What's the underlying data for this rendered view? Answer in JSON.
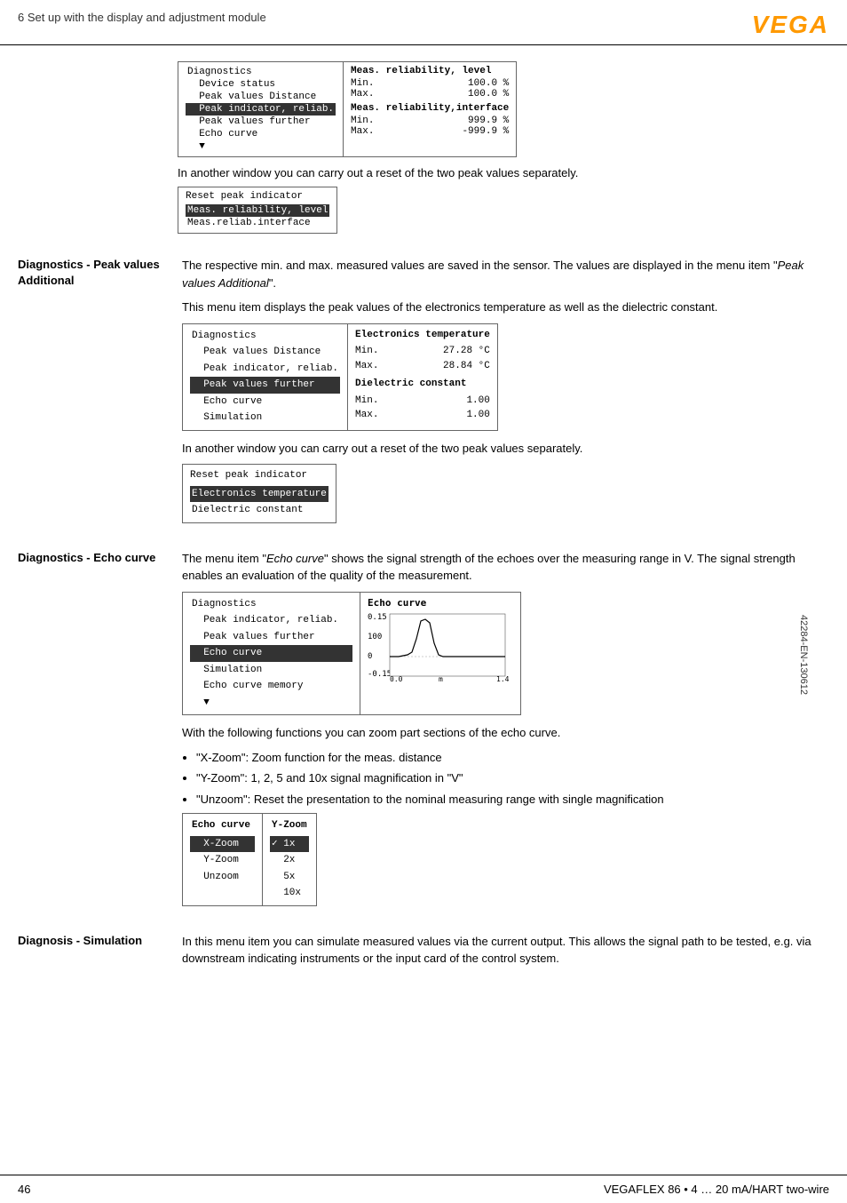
{
  "header": {
    "title": "6 Set up with the display and adjustment module",
    "logo": "VEGA"
  },
  "footer": {
    "page": "46",
    "product": "VEGAFLEX 86 • 4 … 20 mA/HART two-wire"
  },
  "doc_number": "42284-EN-130612",
  "section1": {
    "body_text1": "In another window you can carry out a reset of the two peak values separately.",
    "diagnostics_menu": {
      "title": "Diagnostics",
      "items": [
        "Device status",
        "Peak values Distance",
        "Peak indicator, reliab.",
        "Peak values further",
        "Echo curve"
      ]
    },
    "meas_panel": {
      "title1": "Meas. reliability, level",
      "min1_label": "Min.",
      "min1_value": "100.0 %",
      "max1_label": "Max.",
      "max1_value": "100.0 %",
      "title2": "Meas. reliability,interface",
      "min2_label": "Min.",
      "min2_value": "999.9 %",
      "max2_label": "Max.",
      "max2_value": "-999.9 %"
    },
    "reset_box_title": "Reset peak indicator",
    "reset_items": [
      "Meas. reliability, level",
      "Meas.reliab.interface"
    ]
  },
  "section2": {
    "label": "Diagnostics - Peak values Additional",
    "text1": "The respective min. and max. measured values are saved in the sensor. The values are displayed in the menu item ",
    "italic_text": "Peak values Additional",
    "text1b": "\".",
    "text2": "This menu item displays the peak values of the electronics temperature as well as the dielectric constant.",
    "diag_menu": {
      "items": [
        "Diagnostics",
        "Peak values Distance",
        "Peak indicator, reliab.",
        "Peak values further",
        "Echo curve",
        "Simulation"
      ]
    },
    "diag_panel": {
      "title": "Electronics temperature",
      "min_label": "Min.",
      "min_value": "27.28 °C",
      "max_label": "Max.",
      "max_value": "28.84 °C",
      "section2_title": "Dielectric constant",
      "min2_label": "Min.",
      "min2_value": "1.00",
      "max2_label": "Max.",
      "max2_value": "1.00"
    },
    "body_text2": "In another window you can carry out a reset of the two peak values separately.",
    "reset_box2_title": "Reset peak indicator",
    "reset2_items": [
      "Electronics temperature",
      "Dielectric constant"
    ]
  },
  "section3": {
    "label": "Diagnostics - Echo curve",
    "text1": "The menu item \"",
    "italic_text": "Echo curve",
    "text1b": "\" shows the signal strength of the echoes over the measuring range in V. The signal strength enables an evaluation of the quality of the measurement.",
    "diag_menu": {
      "items": [
        "Diagnostics",
        "Peak indicator, reliab.",
        "Peak values further",
        "Echo curve",
        "Simulation",
        "Echo curve memory"
      ]
    },
    "echo_panel_title": "Echo curve",
    "echo_y_max": "0.15",
    "echo_y_mid": "100",
    "echo_y_zero": "0",
    "echo_y_min": "-0.15",
    "echo_x_start": "0.0",
    "echo_x_label": "m",
    "echo_x_end": "1.4",
    "body_text2": "With the following functions you can zoom part sections of the echo curve.",
    "bullet1": "\"X-Zoom\": Zoom function for the meas. distance",
    "bullet2": "\"Y-Zoom\": 1, 2, 5 and 10x signal magnification in \"V\"",
    "bullet3": "\"Unzoom\": Reset the presentation to the nominal measuring range with single magnification",
    "zoom_menu": {
      "title": "Echo curve",
      "items": [
        "X-Zoom",
        "Y-Zoom",
        "Unzoom"
      ]
    },
    "yzoom_panel_title": "Y-Zoom",
    "yzoom_items": [
      "1x",
      "2x",
      "5x",
      "10x"
    ],
    "yzoom_selected": "1x"
  },
  "section4": {
    "label": "Diagnosis - Simulation",
    "text": "In this menu item you can simulate measured values via the current output. This allows the signal path to be tested, e.g. via downstream indicating instruments or the input card of the control system."
  }
}
